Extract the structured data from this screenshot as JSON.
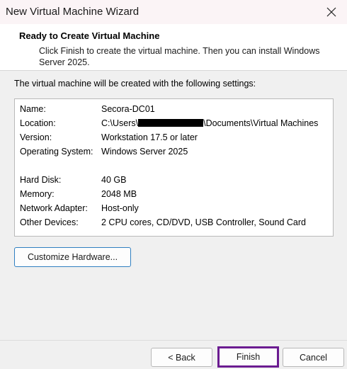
{
  "window": {
    "title": "New Virtual Machine Wizard",
    "close_icon": "close-icon"
  },
  "header": {
    "title": "Ready to Create Virtual Machine",
    "description": "Click Finish to create the virtual machine. Then you can install Windows Server 2025."
  },
  "intro": "The virtual machine will be created with the following settings:",
  "settings": {
    "name": {
      "label": "Name:",
      "value": "Secora-DC01"
    },
    "location": {
      "label": "Location:",
      "prefix": "C:\\Users\\",
      "suffix": "\\Documents\\Virtual Machines"
    },
    "version": {
      "label": "Version:",
      "value": "Workstation 17.5 or later"
    },
    "os": {
      "label": "Operating System:",
      "value": "Windows Server 2025"
    },
    "disk": {
      "label": "Hard Disk:",
      "value": "40 GB"
    },
    "memory": {
      "label": "Memory:",
      "value": "2048 MB"
    },
    "network": {
      "label": "Network Adapter:",
      "value": "Host-only"
    },
    "devices": {
      "label": "Other Devices:",
      "value": "2 CPU cores, CD/DVD, USB Controller, Sound Card"
    }
  },
  "buttons": {
    "customize": "Customize Hardware...",
    "back": "< Back",
    "finish": "Finish",
    "cancel": "Cancel"
  },
  "colors": {
    "finish_highlight": "#6b1c91",
    "customize_focus": "#2f7fc1"
  }
}
